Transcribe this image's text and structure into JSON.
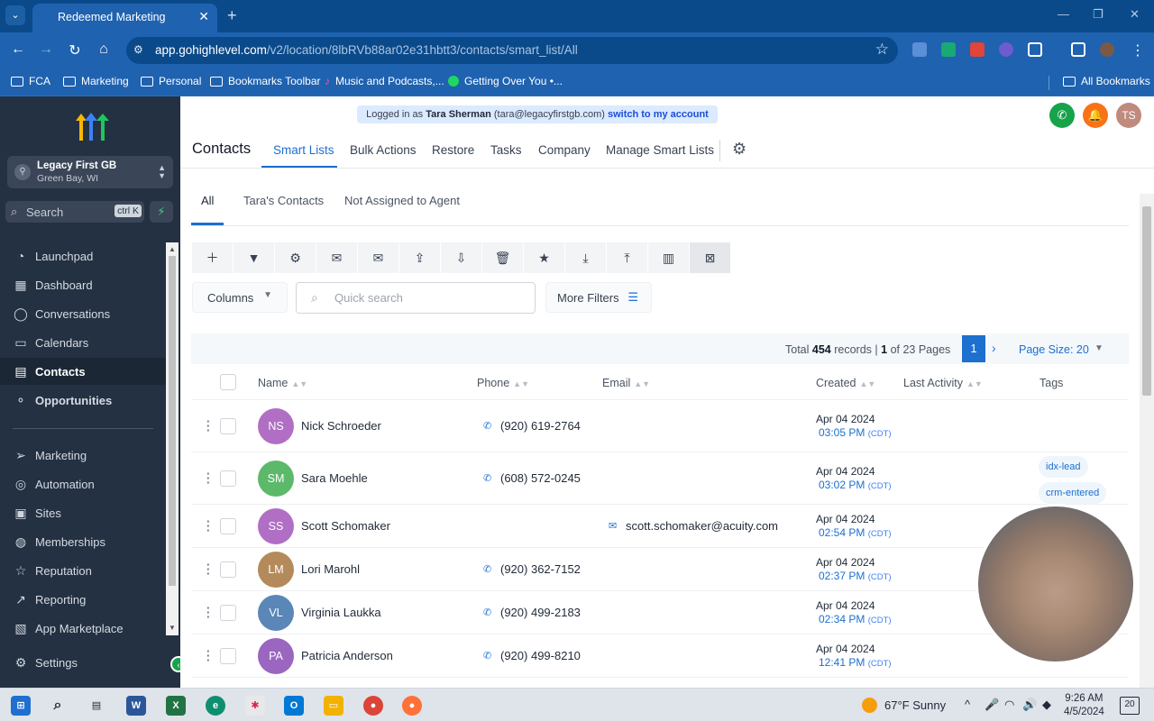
{
  "browser": {
    "tab_title": "Redeemed Marketing",
    "url_host": "app.gohighlevel.com",
    "url_path": "/v2/location/8lbRVb88ar02e31hbtt3/contacts/smart_list/All",
    "bookmarks": [
      "FCA",
      "Marketing",
      "Personal",
      "Bookmarks Toolbar",
      "Music and Podcasts,...",
      "Getting Over You •...",
      "All Bookmarks"
    ]
  },
  "sidebar": {
    "location_name": "Legacy First GB",
    "location_sub": "Green Bay, WI",
    "search_label": "Search",
    "search_kbd": "ctrl K",
    "items": [
      {
        "label": "Launchpad",
        "icon": "launchpad-icon"
      },
      {
        "label": "Dashboard",
        "icon": "dashboard-icon"
      },
      {
        "label": "Conversations",
        "icon": "chat-icon"
      },
      {
        "label": "Calendars",
        "icon": "calendar-icon"
      },
      {
        "label": "Contacts",
        "icon": "contacts-icon",
        "active": true
      },
      {
        "label": "Opportunities",
        "icon": "opportunities-icon"
      },
      {
        "label": "Marketing",
        "icon": "send-icon"
      },
      {
        "label": "Automation",
        "icon": "automation-icon"
      },
      {
        "label": "Sites",
        "icon": "sites-icon"
      },
      {
        "label": "Memberships",
        "icon": "memberships-icon"
      },
      {
        "label": "Reputation",
        "icon": "star-icon"
      },
      {
        "label": "Reporting",
        "icon": "reporting-icon"
      },
      {
        "label": "App Marketplace",
        "icon": "marketplace-icon"
      }
    ],
    "settings_label": "Settings"
  },
  "header": {
    "logged_in_prefix": "Logged in as",
    "user_name": "Tara Sherman",
    "user_email": "(tara@legacyfirstgb.com)",
    "switch_label": "switch to my account",
    "avatar_initials": "TS"
  },
  "topnav": {
    "title": "Contacts",
    "links": [
      "Smart Lists",
      "Bulk Actions",
      "Restore",
      "Tasks",
      "Company",
      "Manage Smart Lists"
    ]
  },
  "subtabs": [
    "All",
    "Tara's Contacts",
    "Not Assigned to Agent"
  ],
  "filters": {
    "columns_label": "Columns",
    "search_placeholder": "Quick search",
    "more_filters_label": "More Filters"
  },
  "pagination": {
    "total_prefix": "Total",
    "total_records": "454",
    "records_label": "records |",
    "current_page": "1",
    "of_label": "of 23 Pages",
    "page_button": "1",
    "page_size_label": "Page Size: 20"
  },
  "table": {
    "columns": [
      "Name",
      "Phone",
      "Email",
      "Created",
      "Last Activity",
      "Tags"
    ],
    "rows": [
      {
        "initials": "NS",
        "color": "#b06fc4",
        "name": "Nick Schroeder",
        "phone": "(920) 619-2764",
        "email": "",
        "date": "Apr 04 2024",
        "time": "03:05 PM",
        "tz": "(CDT)",
        "tags": []
      },
      {
        "initials": "SM",
        "color": "#5cb96a",
        "name": "Sara Moehle",
        "phone": "(608) 572-0245",
        "email": "",
        "date": "Apr 04 2024",
        "time": "03:02 PM",
        "tz": "(CDT)",
        "tags": [
          "idx-lead",
          "crm-entered"
        ]
      },
      {
        "initials": "SS",
        "color": "#b06fc4",
        "name": "Scott Schomaker",
        "phone": "",
        "email": "scott.schomaker@acuity.com",
        "date": "Apr 04 2024",
        "time": "02:54 PM",
        "tz": "(CDT)",
        "tags": []
      },
      {
        "initials": "LM",
        "color": "#b58a5a",
        "name": "Lori Marohl",
        "phone": "(920) 362-7152",
        "email": "",
        "date": "Apr 04 2024",
        "time": "02:37 PM",
        "tz": "(CDT)",
        "tags": []
      },
      {
        "initials": "VL",
        "color": "#5a86b8",
        "name": "Virginia Laukka",
        "phone": "(920) 499-2183",
        "email": "",
        "date": "Apr 04 2024",
        "time": "02:34 PM",
        "tz": "(CDT)",
        "tags": []
      },
      {
        "initials": "PA",
        "color": "#9a66c0",
        "name": "Patricia Anderson",
        "phone": "(920) 499-8210",
        "email": "",
        "date": "Apr 04 2024",
        "time": "12:41 PM",
        "tz": "(CDT)",
        "tags": []
      }
    ]
  },
  "taskbar": {
    "weather": "67°F  Sunny",
    "time": "9:26 AM",
    "date": "4/5/2024",
    "notifications": "20"
  }
}
